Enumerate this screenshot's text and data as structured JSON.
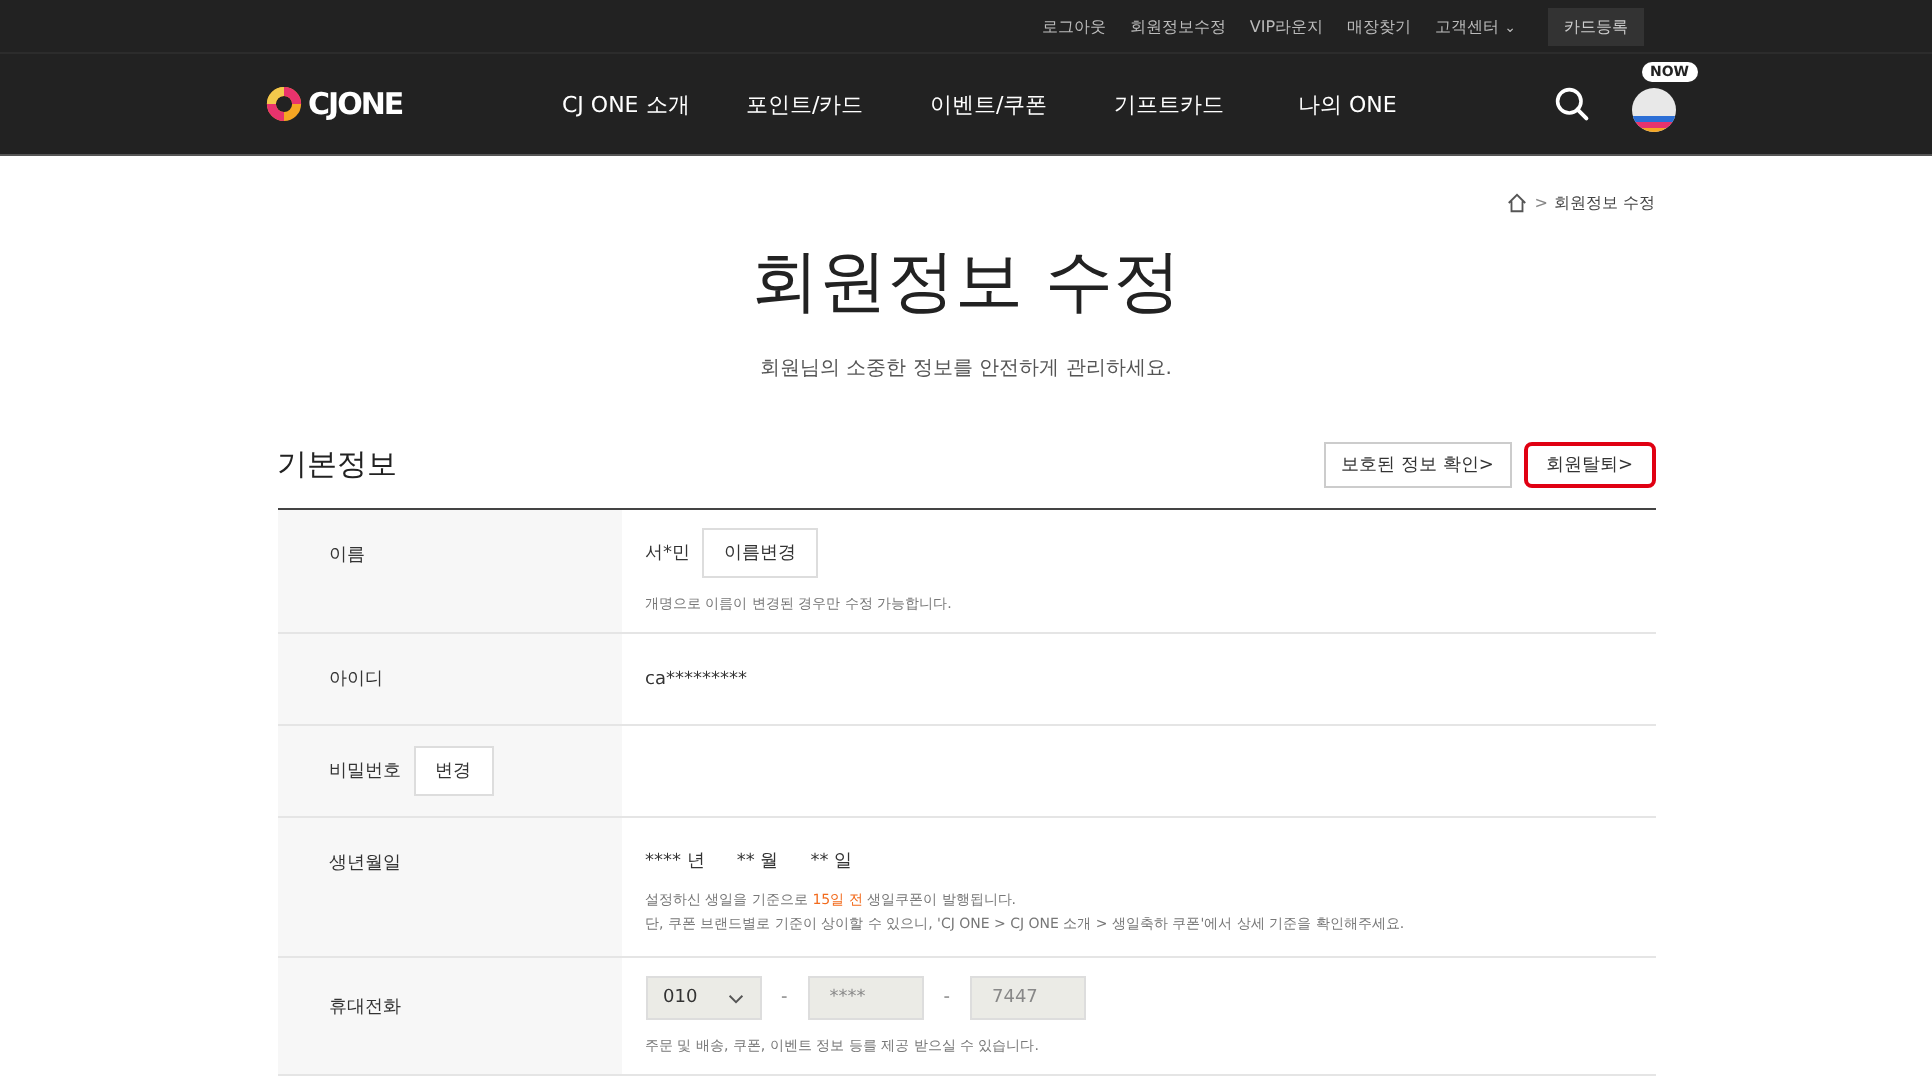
{
  "top_links": [
    "로그아웃",
    "회원정보수정",
    "VIP라운지",
    "매장찾기"
  ],
  "support_menu": {
    "label": "고객센터",
    "caret": "⌄"
  },
  "card_button": "카드등록",
  "logo": "CJONE",
  "nav": [
    "CJ ONE 소개",
    "포인트/카드",
    "이벤트/쿠폰",
    "기프트카드",
    "나의 ONE"
  ],
  "now_badge": "NOW",
  "breadcrumb": {
    "separator": ">",
    "current": "회원정보 수정"
  },
  "title": "회원정보 수정",
  "subtitle": "회원님의 소중한 정보를 안전하게 관리하세요.",
  "section": {
    "title": "기본정보",
    "buttons": [
      {
        "label": "보호된 정보 확인>",
        "highlighted": false
      },
      {
        "label": "회원탈퇴>",
        "highlighted": true
      }
    ]
  },
  "rows": [
    {
      "kind": "name",
      "label": "이름",
      "value": "서*민",
      "button": "이름변경",
      "note": "개명으로 이름이 변경된 경우만 수정 가능합니다."
    },
    {
      "kind": "text",
      "label": "아이디",
      "value": "ca*********"
    },
    {
      "kind": "password",
      "label": "비밀번호",
      "button": "변경"
    },
    {
      "kind": "birth",
      "label": "생년월일",
      "parts": [
        {
          "value": "****",
          "unit": "년"
        },
        {
          "value": "**",
          "unit": "월"
        },
        {
          "value": "**",
          "unit": "일"
        }
      ],
      "note_before": "설정하신 생일을 기준으로 ",
      "note_highlight": "15일 전",
      "note_after": " 생일쿠폰이 발행됩니다.",
      "note2": "단, 쿠폰 브랜드별로 기준이 상이할 수 있으니, 'CJ ONE > CJ ONE 소개 > 생일축하 쿠폰'에서 상세 기준을 확인해주세요."
    },
    {
      "kind": "phone",
      "label": "휴대전화",
      "prefix": "010",
      "middle": "****",
      "last": "7447",
      "dash": "-",
      "note": "주문 및 배송, 쿠폰, 이벤트 정보 등를 제공 받으실 수 있습니다."
    }
  ]
}
